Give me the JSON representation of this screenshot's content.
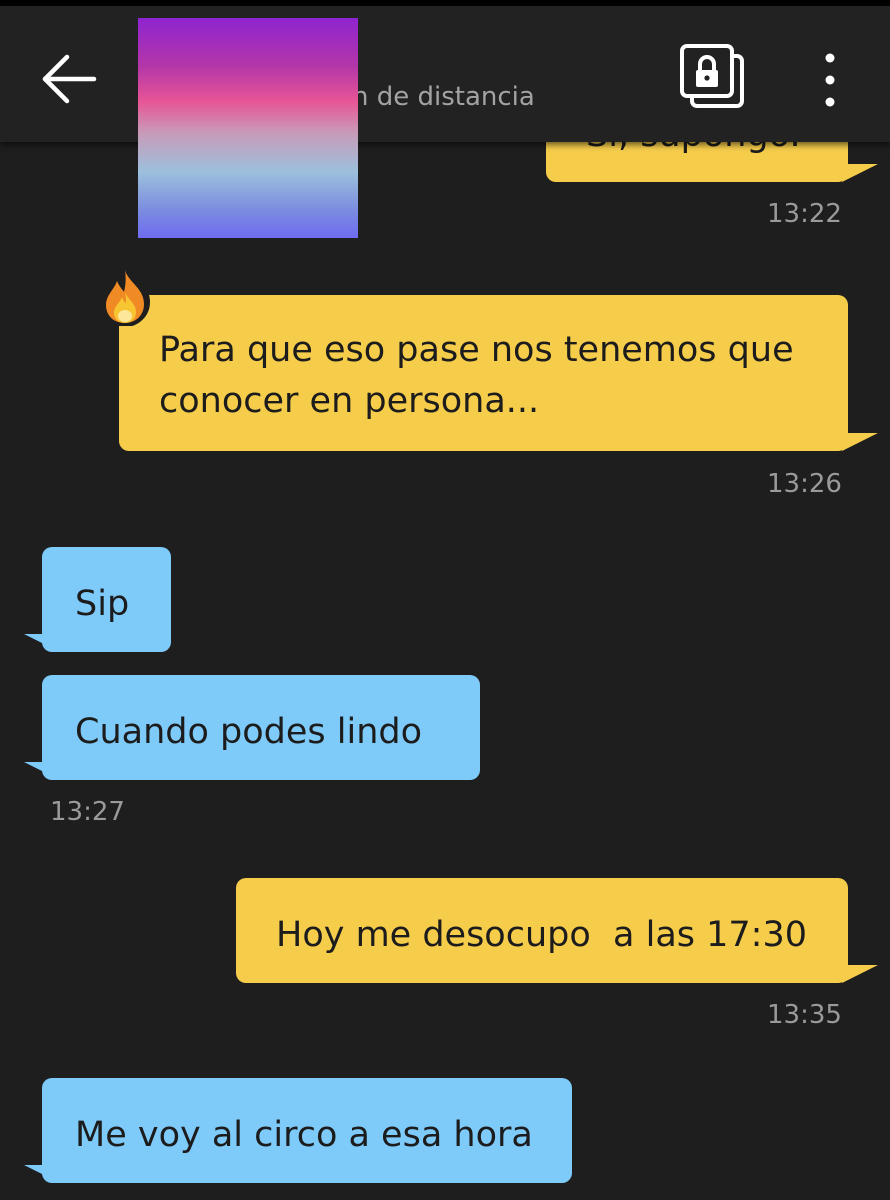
{
  "header": {
    "subtitle": "n de distancia",
    "back_icon": "arrow-left-icon",
    "album_icon": "locked-album-icon",
    "menu_icon": "more-vertical-icon"
  },
  "colors": {
    "background": "#1e1e1f",
    "outgoing_bubble": "#f6cd4b",
    "incoming_bubble": "#7ecbfa",
    "timestamp": "#9a9a9a"
  },
  "messages": [
    {
      "direction": "out",
      "text": "Sí, supongo.",
      "time": "13:22"
    },
    {
      "direction": "out",
      "text": "Para que eso pase nos tenemos que conocer en persona...",
      "time": "13:26",
      "reaction_icon": "fire-icon"
    },
    {
      "direction": "in",
      "text": "Sip"
    },
    {
      "direction": "in",
      "text": "Cuando podes lindo",
      "time": "13:27"
    },
    {
      "direction": "out",
      "text": "Hoy me desocupo  a las 17:30",
      "time": "13:35"
    },
    {
      "direction": "in",
      "text": "Me voy al circo a esa hora"
    }
  ]
}
